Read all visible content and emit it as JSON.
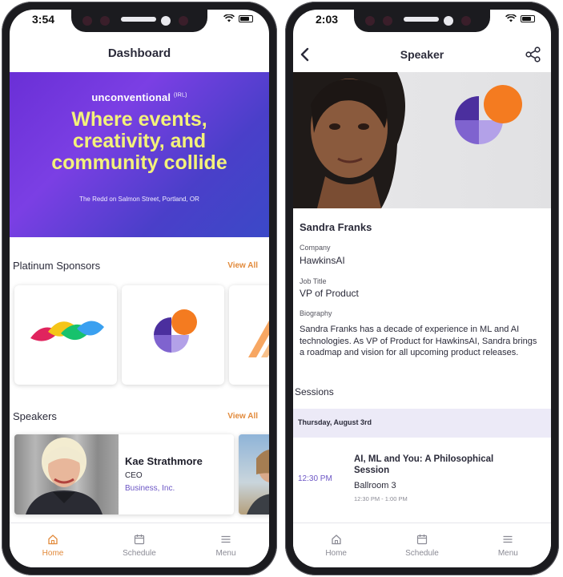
{
  "left_phone": {
    "status": {
      "time": "3:54"
    },
    "header": {
      "title": "Dashboard"
    },
    "banner": {
      "brand": "unconventional",
      "brand_sup": "(IRL)",
      "headline_lines": [
        "Where events,",
        "creativity, and",
        "community collide"
      ],
      "venue": "The Redd on Salmon Street, Portland, OR"
    },
    "sponsors": {
      "title": "Platinum Sponsors",
      "view_all": "View All"
    },
    "speakers": {
      "title": "Speakers",
      "view_all": "View All",
      "items": [
        {
          "name": "Kae Strathmore",
          "role": "CEO",
          "company": "Business, Inc."
        }
      ]
    },
    "tabbar": [
      {
        "label": "Home",
        "icon": "home-icon",
        "active": true
      },
      {
        "label": "Schedule",
        "icon": "calendar-icon",
        "active": false
      },
      {
        "label": "Menu",
        "icon": "menu-icon",
        "active": false
      }
    ]
  },
  "right_phone": {
    "status": {
      "time": "2:03"
    },
    "header": {
      "title": "Speaker"
    },
    "speaker": {
      "name": "Sandra Franks",
      "company_label": "Company",
      "company": "HawkinsAI",
      "job_title_label": "Job Title",
      "job_title": "VP of Product",
      "bio_label": "Biography",
      "bio": "Sandra Franks has a decade of experience in ML and AI technologies. As VP of Product for HawkinsAI, Sandra brings a roadmap and vision for all upcoming product releases."
    },
    "sessions": {
      "title": "Sessions",
      "day": "Thursday, August 3rd",
      "items": [
        {
          "time": "12:30 PM",
          "title": "AI, ML and You: A Philosophical Session",
          "room": "Ballroom 3",
          "range": "12:30 PM - 1:00 PM"
        }
      ]
    },
    "tabbar": [
      {
        "label": "Home",
        "icon": "home-icon"
      },
      {
        "label": "Schedule",
        "icon": "calendar-icon"
      },
      {
        "label": "Menu",
        "icon": "menu-icon"
      }
    ]
  },
  "colors": {
    "accent_orange": "#e28a3b",
    "accent_purple": "#6c56c5",
    "banner_headline": "#f3f27a"
  }
}
